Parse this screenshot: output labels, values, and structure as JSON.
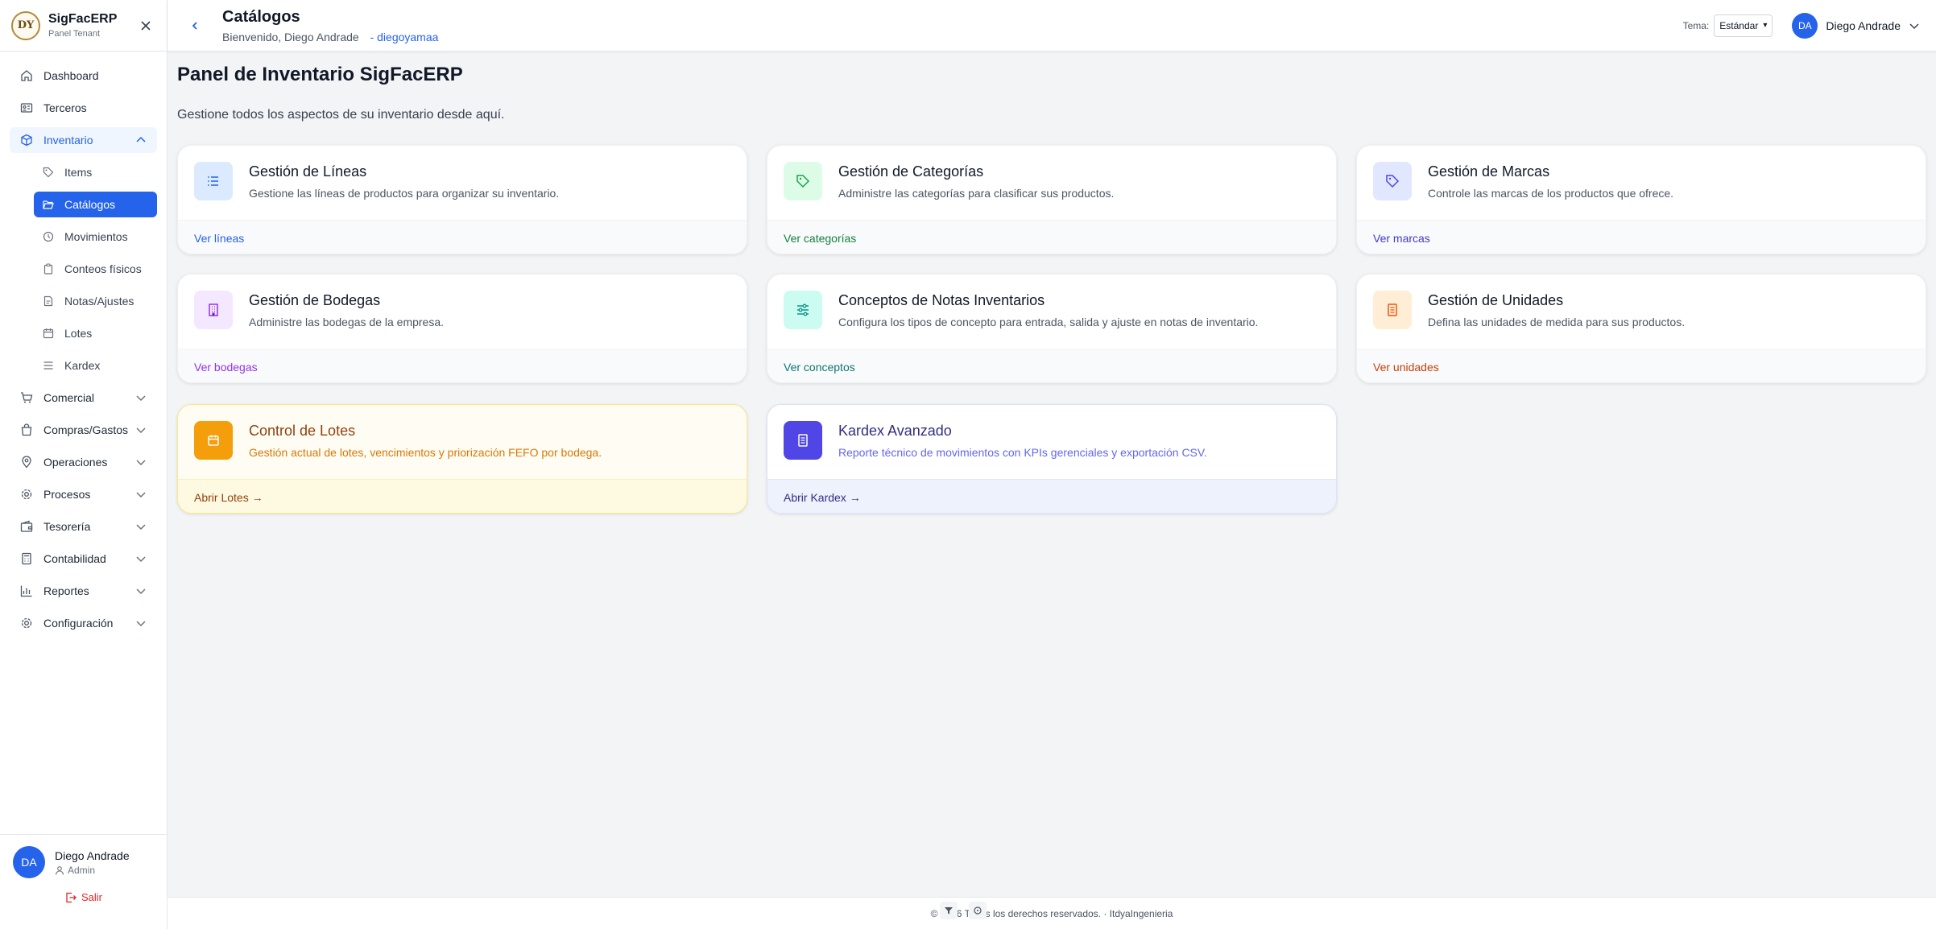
{
  "brand": {
    "logo_text": "DY",
    "title": "SigFacERP",
    "subtitle": "Panel Tenant"
  },
  "sidebar": {
    "items": [
      {
        "label": "Dashboard",
        "icon": "home-icon"
      },
      {
        "label": "Terceros",
        "icon": "id-card-icon"
      },
      {
        "label": "Inventario",
        "icon": "box-icon"
      },
      {
        "label": "Comercial",
        "icon": "cart-icon"
      },
      {
        "label": "Compras/Gastos",
        "icon": "bag-icon"
      },
      {
        "label": "Operaciones",
        "icon": "location-icon"
      },
      {
        "label": "Procesos",
        "icon": "gear-icon"
      },
      {
        "label": "Tesorería",
        "icon": "wallet-icon"
      },
      {
        "label": "Contabilidad",
        "icon": "calculator-icon"
      },
      {
        "label": "Reportes",
        "icon": "chart-icon"
      },
      {
        "label": "Configuración",
        "icon": "gear-icon"
      }
    ],
    "inventario_sub": [
      {
        "label": "Items",
        "icon": "tag-icon"
      },
      {
        "label": "Catálogos",
        "icon": "folder-open-icon"
      },
      {
        "label": "Movimientos",
        "icon": "clock-icon"
      },
      {
        "label": "Conteos físicos",
        "icon": "clipboard-icon"
      },
      {
        "label": "Notas/Ajustes",
        "icon": "note-icon"
      },
      {
        "label": "Lotes",
        "icon": "calendar-icon"
      },
      {
        "label": "Kardex",
        "icon": "list-icon"
      }
    ],
    "user": {
      "initials": "DA",
      "name": "Diego Andrade",
      "role": "Admin"
    },
    "logout_label": "Salir"
  },
  "header": {
    "title": "Catálogos",
    "welcome": "Bienvenido, Diego Andrade",
    "username": "- diegoyamaa",
    "tema_label": "Tema:",
    "tema_value": "Estándar",
    "user_initials": "DA",
    "user_name": "Diego Andrade"
  },
  "main": {
    "title": "Panel de Inventario SigFacERP",
    "description": "Gestione todos los aspectos de su inventario desde aquí.",
    "cards": [
      {
        "title": "Gestión de Líneas",
        "desc": "Gestione las líneas de productos para organizar su inventario.",
        "link": "Ver líneas",
        "icon": "list-icon",
        "color": "#2563eb",
        "bg": "#dbeafe"
      },
      {
        "title": "Gestión de Categorías",
        "desc": "Administre las categorías para clasificar sus productos.",
        "link": "Ver categorías",
        "icon": "tag-icon",
        "color": "#16a34a",
        "bg": "#dcfce7"
      },
      {
        "title": "Gestión de Marcas",
        "desc": "Controle las marcas de los productos que ofrece.",
        "link": "Ver marcas",
        "icon": "tag-icon",
        "color": "#4f46e5",
        "bg": "#e0e7ff"
      },
      {
        "title": "Gestión de Bodegas",
        "desc": "Administre las bodegas de la empresa.",
        "link": "Ver bodegas",
        "icon": "building-icon",
        "color": "#9333ea",
        "bg": "#f3e8ff"
      },
      {
        "title": "Conceptos de Notas Inventarios",
        "desc": "Configura los tipos de concepto para entrada, salida y ajuste en notas de inventario.",
        "link": "Ver conceptos",
        "icon": "sliders-icon",
        "color": "#0d9488",
        "bg": "#ccfbf1"
      },
      {
        "title": "Gestión de Unidades",
        "desc": "Defina las unidades de medida para sus productos.",
        "link": "Ver unidades",
        "icon": "document-icon",
        "color": "#ea580c",
        "bg": "#ffedd5"
      },
      {
        "title": "Control de Lotes",
        "desc": "Gestión actual de lotes, vencimientos y priorización FEFO por bodega.",
        "link": "Abrir Lotes →",
        "icon": "calendar-icon",
        "color": "#d97706",
        "bg": "#f59e0b",
        "title_color": "#92400e",
        "link_color": "#92400e"
      },
      {
        "title": "Kardex Avanzado",
        "desc": "Reporte técnico de movimientos con KPIs gerenciales y exportación CSV.",
        "link": "Abrir Kardex →",
        "icon": "document-icon",
        "color": "#4f46e5",
        "bg": "#4f46e5",
        "title_color": "#312e81",
        "link_color": "#312e81"
      }
    ]
  },
  "footer": {
    "text": "© 2026 Todos los derechos reservados. · ItdyaIngenieria"
  }
}
